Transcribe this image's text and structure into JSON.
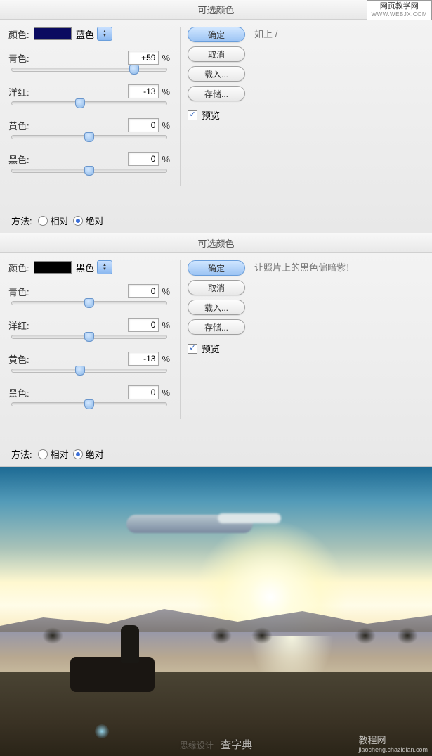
{
  "watermark_top": {
    "main": "网页教学网",
    "sub": "WWW.WEBJX.COM"
  },
  "panel1": {
    "title": "可选颜色",
    "note": "如上 /",
    "color_label": "颜色:",
    "color_name": "蓝色",
    "buttons": {
      "ok": "确定",
      "cancel": "取消",
      "load": "载入...",
      "save": "存储..."
    },
    "preview_label": "预览",
    "sliders": {
      "cyan": {
        "label": "青色:",
        "value": "+59",
        "pos": 79
      },
      "magenta": {
        "label": "洋红:",
        "value": "-13",
        "pos": 44
      },
      "yellow": {
        "label": "黄色:",
        "value": "0",
        "pos": 50
      },
      "black": {
        "label": "黑色:",
        "value": "0",
        "pos": 50
      }
    },
    "method": {
      "label": "方法:",
      "relative": "相对",
      "absolute": "绝对"
    }
  },
  "panel2": {
    "title": "可选颜色",
    "note": "让照片上的黑色偏暗紫！",
    "color_label": "颜色:",
    "color_name": "黑色",
    "buttons": {
      "ok": "确定",
      "cancel": "取消",
      "load": "载入...",
      "save": "存储..."
    },
    "preview_label": "预览",
    "sliders": {
      "cyan": {
        "label": "青色:",
        "value": "0",
        "pos": 50
      },
      "magenta": {
        "label": "洋红:",
        "value": "0",
        "pos": 50
      },
      "yellow": {
        "label": "黄色:",
        "value": "-13",
        "pos": 44
      },
      "black": {
        "label": "黑色:",
        "value": "0",
        "pos": 50
      }
    },
    "method": {
      "label": "方法:",
      "relative": "相对",
      "absolute": "绝对"
    }
  },
  "photo_wm": {
    "center": "查字典",
    "right_main": "教程网",
    "right_sub": "jiaocheng.chazidian.com",
    "left_faint": "思缘设计"
  }
}
